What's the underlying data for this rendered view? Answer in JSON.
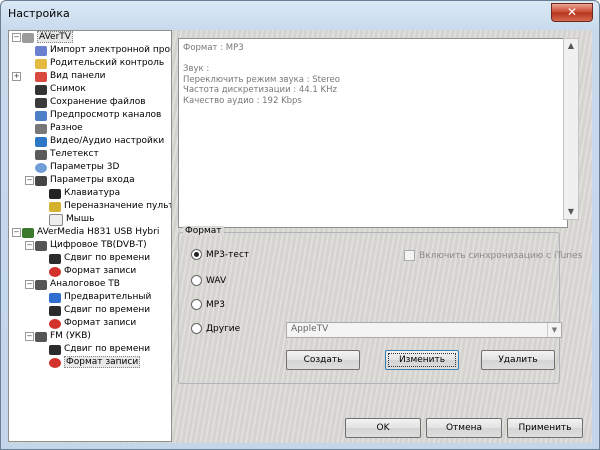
{
  "window": {
    "title": "Настройка"
  },
  "tree": [
    {
      "label": "AVerTV",
      "icon": "app-icon"
    },
    {
      "label": "Импорт электронной прогр",
      "icon": "import-icon"
    },
    {
      "label": "Родительский контроль",
      "icon": "lock-icon"
    },
    {
      "label": "Вид панели",
      "icon": "panel-icon"
    },
    {
      "label": "Снимок",
      "icon": "camera-icon"
    },
    {
      "label": "Сохранение файлов",
      "icon": "disk-icon"
    },
    {
      "label": "Предпросмотр каналов",
      "icon": "eye-icon"
    },
    {
      "label": "Разное",
      "icon": "misc-icon"
    },
    {
      "label": "Видео/Аудио настройки",
      "icon": "tools-icon"
    },
    {
      "label": "Телетекст",
      "icon": "teletext-icon"
    },
    {
      "label": "Параметры 3D",
      "icon": "3d-icon"
    },
    {
      "label": "Параметры входа",
      "icon": "input-icon"
    },
    {
      "label": "Клавиатура",
      "icon": "keyboard-icon"
    },
    {
      "label": "Переназначение пульт",
      "icon": "remote-icon"
    },
    {
      "label": "Мышь",
      "icon": "mouse-icon"
    },
    {
      "label": "AVerMedia H831 USB Hybri",
      "icon": "device-icon"
    },
    {
      "label": "Цифровое ТВ(DVB-T)",
      "icon": "tv-icon"
    },
    {
      "label": "Сдвиг по времени",
      "icon": "timeshift-icon"
    },
    {
      "label": "Формат записи",
      "icon": "record-icon"
    },
    {
      "label": "Аналоговое ТВ",
      "icon": "tv-icon"
    },
    {
      "label": "Предварительный",
      "icon": "check-icon"
    },
    {
      "label": "Сдвиг по времени",
      "icon": "timeshift-icon"
    },
    {
      "label": "Формат записи",
      "icon": "record-icon"
    },
    {
      "label": "FM (УКВ)",
      "icon": "radio-icon"
    },
    {
      "label": "Сдвиг по времени",
      "icon": "timeshift-icon"
    },
    {
      "label": "Формат записи",
      "icon": "record-icon"
    }
  ],
  "info": {
    "lines": [
      "Формат : MP3",
      "",
      "Звук :",
      "Переключить режим звука : Stereo",
      "Частота дискретизации : 44.1 KHz",
      "Качество аудио : 192 Kbps"
    ]
  },
  "format": {
    "group_title": "Формат",
    "options": [
      "MP3-тест",
      "WAV",
      "MP3",
      "Другие"
    ],
    "selected": "MP3-тест",
    "itunes_label": "Включить синхронизацию с iTunes",
    "combo_value": "AppleTV",
    "buttons": {
      "create": "Создать",
      "edit": "Изменить",
      "delete": "Удалить"
    }
  },
  "dialog_buttons": {
    "ok": "OK",
    "cancel": "Отмена",
    "apply": "Применить"
  },
  "colors": {
    "accent": "#c9452d",
    "selection": "#e8e8e8",
    "panel": "#dcdad6"
  }
}
